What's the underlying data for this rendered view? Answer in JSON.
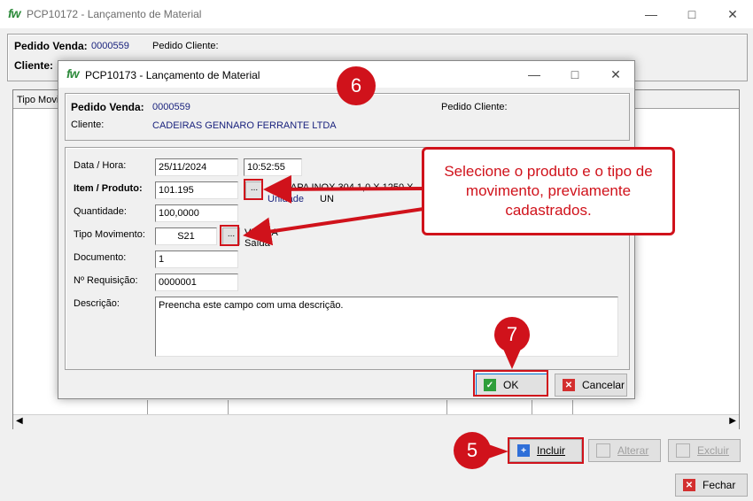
{
  "main_window": {
    "logo": "fw",
    "title": "PCP10172 - Lançamento de Material",
    "pedido_venda_label": "Pedido Venda:",
    "pedido_venda_value": "0000559",
    "pedido_cliente_label": "Pedido Cliente:",
    "cliente_label": "Cliente:",
    "grid_header_first": "Tipo Movi",
    "buttons": {
      "incluir": "Incluir",
      "alterar": "Alterar",
      "excluir": "Excluir",
      "fechar": "Fechar"
    }
  },
  "dialog": {
    "logo": "fw",
    "title": "PCP10173 - Lançamento de Material",
    "pedido_venda_label": "Pedido Venda:",
    "pedido_venda_value": "0000559",
    "pedido_cliente_label": "Pedido Cliente:",
    "cliente_label": "Cliente:",
    "cliente_value": "CADEIRAS GENNARO FERRANTE LTDA",
    "data_hora_label": "Data / Hora:",
    "data_value": "25/11/2024",
    "hora_value": "10:52:55",
    "item_label": "Item / Produto:",
    "item_value": "101.195",
    "item_desc": "CHAPA INOX 304 1,0 X 1250 X",
    "unidade_label": "Unidade",
    "unidade_value": "UN",
    "quantidade_label": "Quantidade:",
    "quantidade_value": "100,0000",
    "tipo_mov_label": "Tipo Movimento:",
    "tipo_mov_value": "S21",
    "tipo_mov_desc1": "VENDA",
    "tipo_mov_desc2": "Saída",
    "documento_label": "Documento:",
    "documento_value": "1",
    "requisicao_label": "Nº Requisição:",
    "requisicao_value": "0000001",
    "descricao_label": "Descrição:",
    "descricao_value": "Preencha este campo com uma descrição.",
    "ellipsis": "...",
    "ok_label": "OK",
    "cancelar_label": "Cancelar"
  },
  "annotations": {
    "callout_text": "Selecione o produto e o tipo de movimento, previamente cadastrados.",
    "step5": "5",
    "step6": "6",
    "step7": "7",
    "accent_color": "#d0121b"
  }
}
